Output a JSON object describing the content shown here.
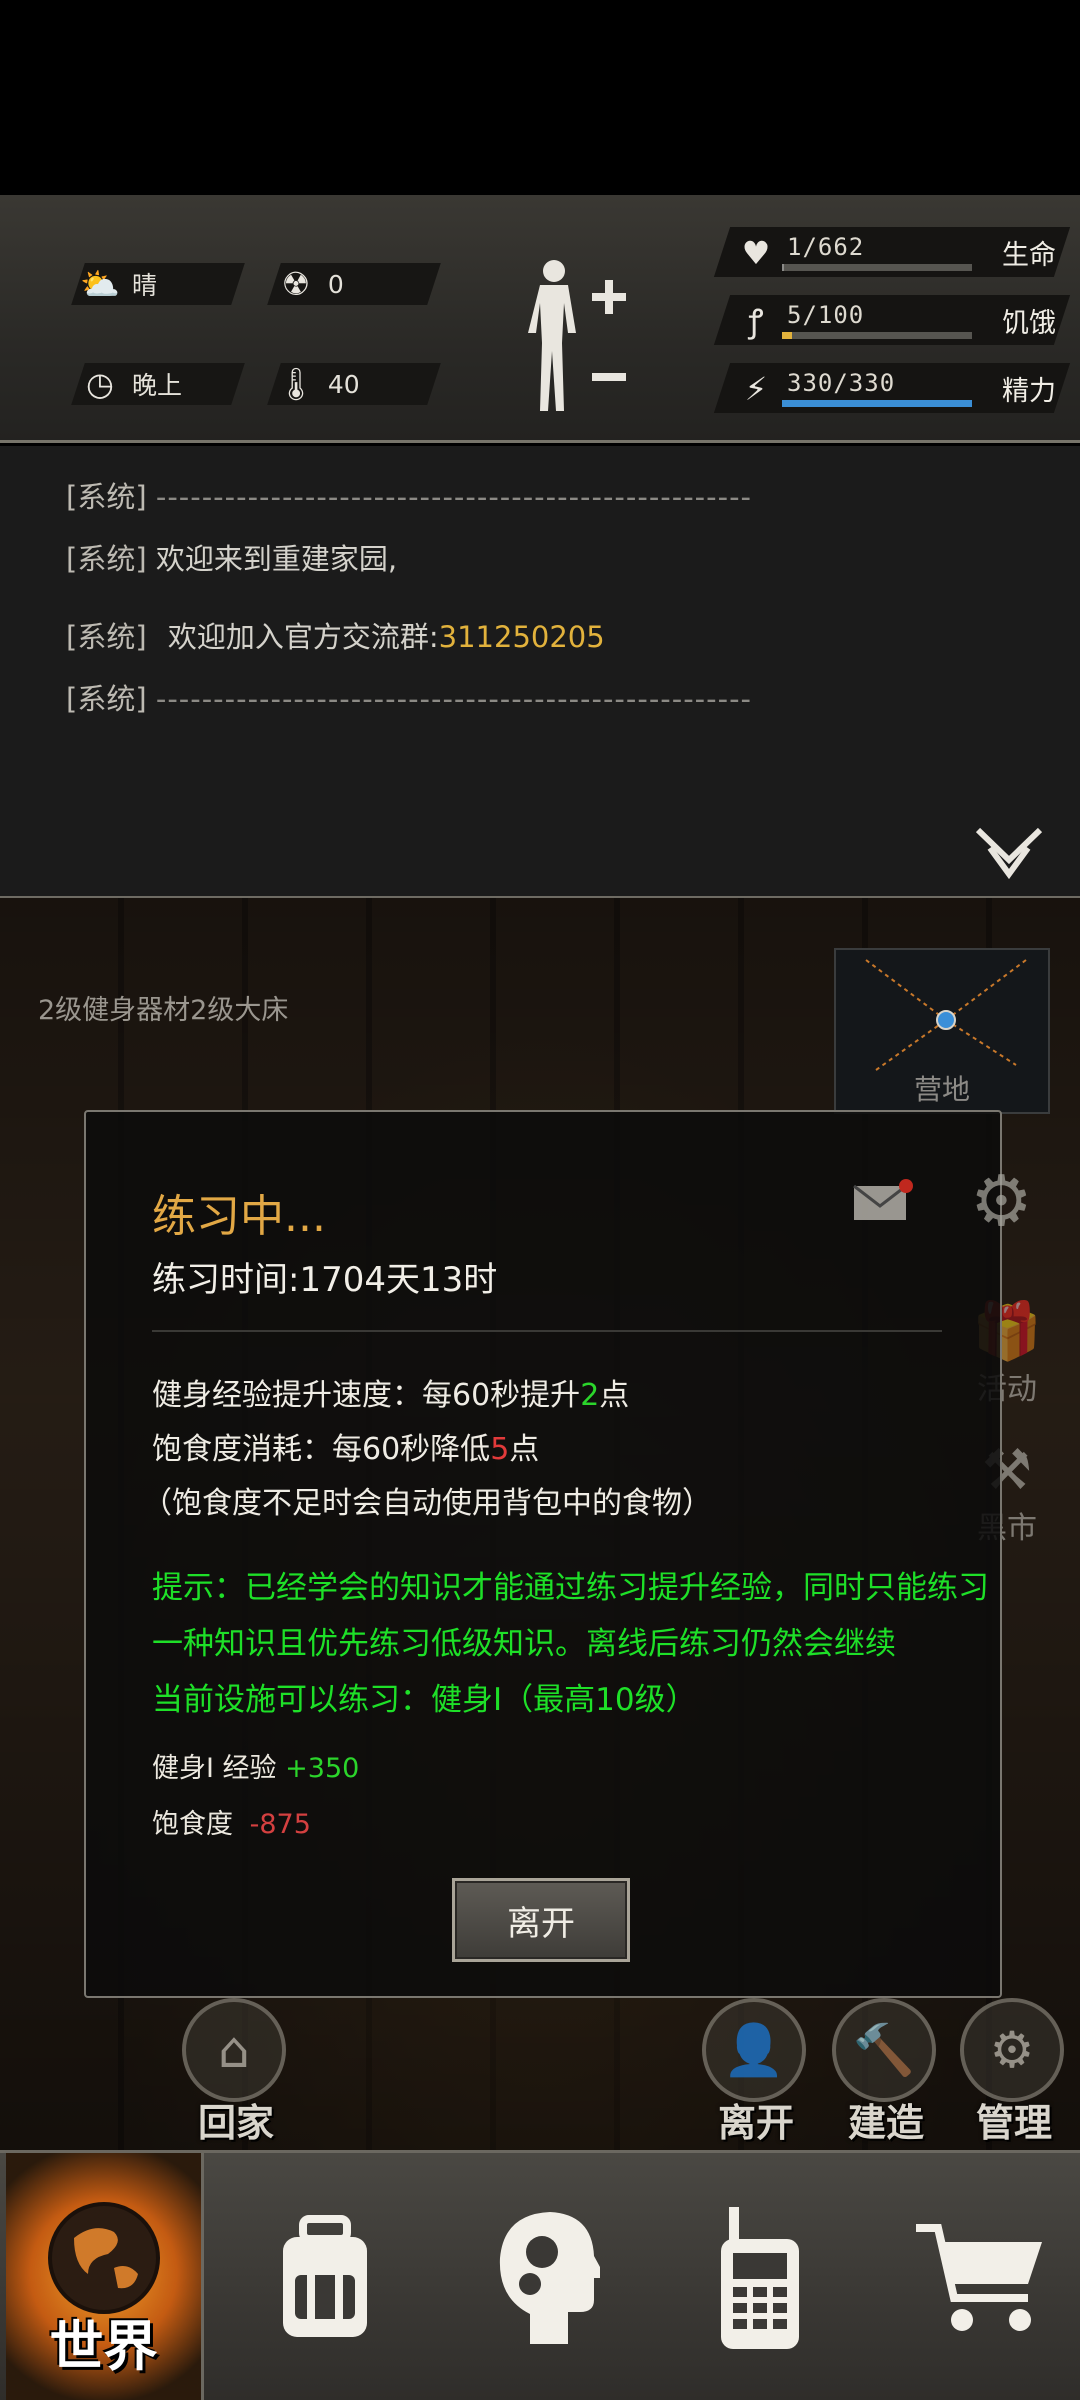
{
  "hud": {
    "weather": {
      "icon": "cloud-sun-icon",
      "label": "晴"
    },
    "radiation": {
      "icon": "radiation-icon",
      "value": "0"
    },
    "time_of_day": {
      "icon": "clock-icon",
      "label": "晚上"
    },
    "temperature": {
      "icon": "thermometer-icon",
      "value": "40"
    },
    "stats": [
      {
        "name": "生命",
        "value": "1/662",
        "icon": "heart-icon",
        "fraction": 0.0015,
        "color": "#8b8b88"
      },
      {
        "name": "饥饿",
        "value": "5/100",
        "icon": "stomach-icon",
        "fraction": 0.05,
        "color": "#e2b23c"
      },
      {
        "name": "精力",
        "value": "330/330",
        "icon": "energy-head-icon",
        "fraction": 1.0,
        "color": "#3b8fd6"
      }
    ]
  },
  "log": {
    "tag": "[系统]",
    "lines": [
      {
        "text": "----------------------------------------------------"
      },
      {
        "text": "欢迎来到重建家园,"
      },
      {
        "text": "欢迎加入官方交流群:",
        "group": "311250205"
      },
      {
        "text": "----------------------------------------------------"
      }
    ]
  },
  "scene": {
    "facilities": "2级健身器材2级大床",
    "camp_label": "营地",
    "side": {
      "activity": "活动",
      "black_market": "黑市"
    }
  },
  "modal": {
    "title": "练习中...",
    "time": "练习时间:1704天13时",
    "exp_rate_prefix": "健身经验提升速度：每60秒提升",
    "exp_rate_num": "2",
    "exp_rate_suffix": "点",
    "food_prefix": "饱食度消耗：每60秒降低",
    "food_num": "5",
    "food_suffix": "点",
    "food_note": "（饱食度不足时会自动使用背包中的食物）",
    "tip1": "提示：已经学会的知识才能通过练习提升经验，同时只能练习",
    "tip2": "一种知识且优先练习低级知识。离线后练习仍然会继续",
    "tip3": "当前设施可以练习：健身Ⅰ（最高10级）",
    "exp_label": "健身Ⅰ 经验",
    "exp_gain": "+350",
    "food_label": "饱食度",
    "food_loss": "-875",
    "leave_button": "离开"
  },
  "actions": {
    "home": "回家",
    "leave": "离开",
    "build": "建造",
    "manage": "管理"
  },
  "nav": {
    "world": "世界"
  }
}
